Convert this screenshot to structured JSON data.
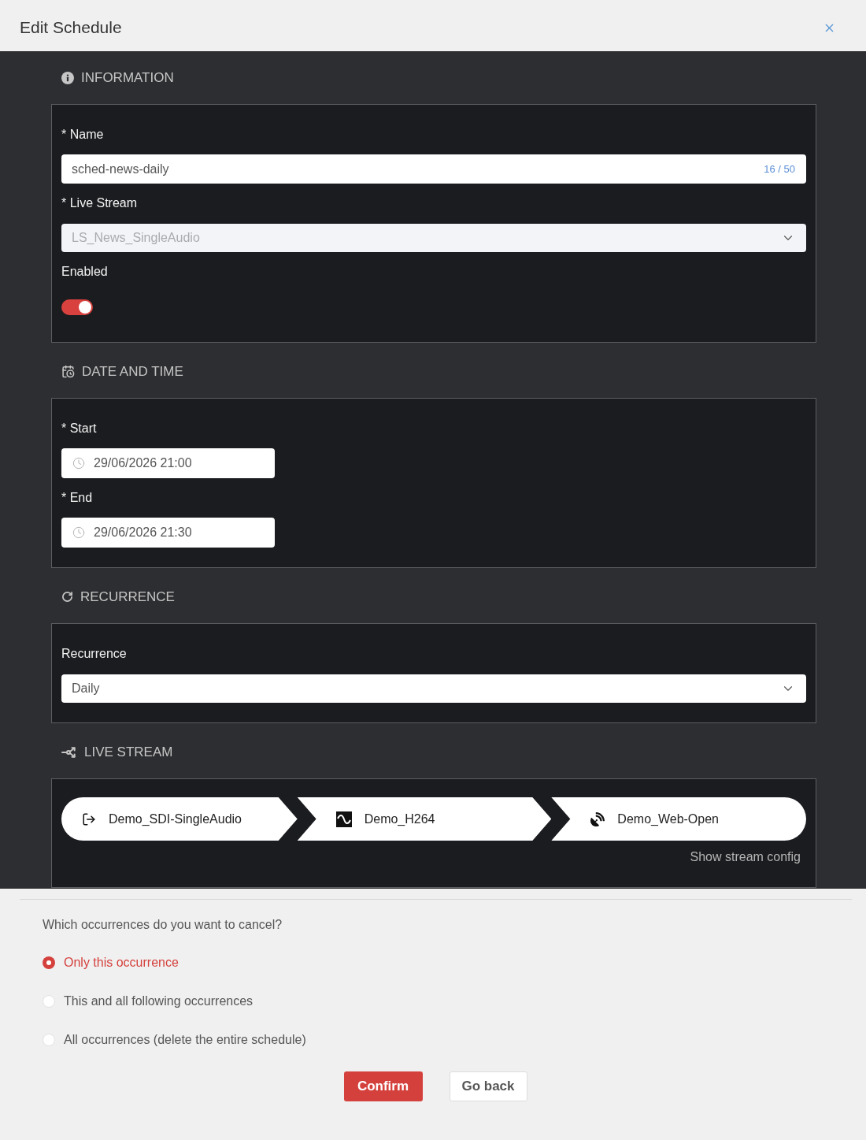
{
  "dialog": {
    "title": "Edit Schedule"
  },
  "sections": [
    {
      "kind": "information",
      "heading": "INFORMATION",
      "fields": [
        {
          "kind": "text",
          "label": "* Name",
          "value": "sched-news-daily",
          "counter": "16 / 50"
        },
        {
          "kind": "select",
          "label": "* Live Stream",
          "value": "LS_News_SingleAudio",
          "disabled": true
        },
        {
          "kind": "toggle",
          "label": "Enabled",
          "on": true
        }
      ]
    },
    {
      "kind": "date_time",
      "heading": "DATE AND TIME",
      "fields": [
        {
          "kind": "datetime",
          "label": "* Start",
          "value": "29/06/2026 21:00"
        },
        {
          "kind": "datetime",
          "label": "* End",
          "value": "29/06/2026 21:30"
        }
      ]
    },
    {
      "kind": "recurrence",
      "heading": "RECURRENCE",
      "fields": [
        {
          "kind": "select",
          "label": "Recurrence",
          "value": "Daily",
          "disabled": false
        }
      ]
    },
    {
      "kind": "live_stream",
      "heading": "LIVE STREAM",
      "steps": [
        {
          "kind": "input",
          "label": "Demo_SDI-SingleAudio"
        },
        {
          "kind": "encoder",
          "label": "Demo_H264"
        },
        {
          "kind": "output",
          "label": "Demo_Web-Open"
        }
      ],
      "link": "Show stream config"
    }
  ],
  "cancel_prompt": {
    "question": "Which occurrences do you want to cancel?",
    "options": [
      {
        "label": "Only this occurrence",
        "selected": true
      },
      {
        "label": "This and all following occurrences",
        "selected": false
      },
      {
        "label": "All occurrences (delete the entire schedule)",
        "selected": false
      }
    ],
    "buttons": [
      {
        "kind": "primary",
        "label": "Confirm"
      },
      {
        "kind": "secondary",
        "label": "Go back"
      }
    ]
  }
}
